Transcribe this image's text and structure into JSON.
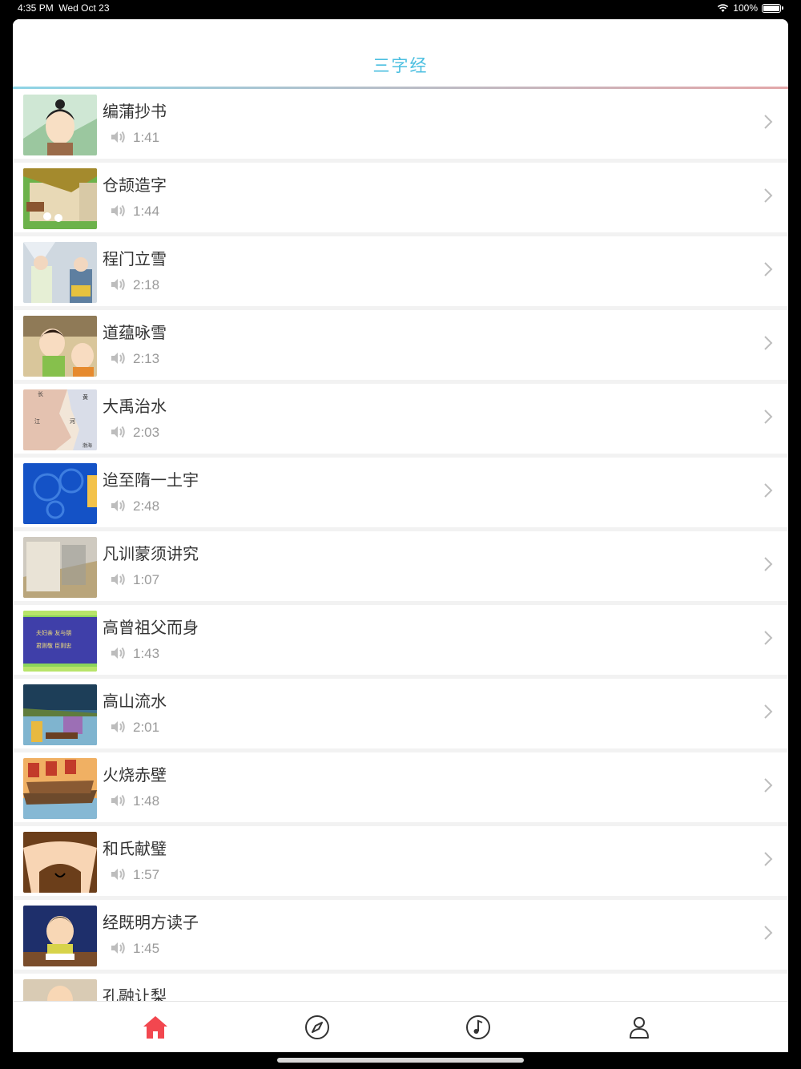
{
  "status": {
    "time": "4:35 PM",
    "date": "Wed Oct 23",
    "battery": "100%"
  },
  "nav": {
    "title": "三字经"
  },
  "items": [
    {
      "title": "编蒲抄书",
      "duration": "1:41",
      "thumb_theme": "girl-portrait"
    },
    {
      "title": "仓颉造字",
      "duration": "1:44",
      "thumb_theme": "house-scene"
    },
    {
      "title": "程门立雪",
      "duration": "2:18",
      "thumb_theme": "snow-scholars"
    },
    {
      "title": "道蕴咏雪",
      "duration": "2:13",
      "thumb_theme": "children"
    },
    {
      "title": "大禹治水",
      "duration": "2:03",
      "thumb_theme": "map"
    },
    {
      "title": "迨至隋一土宇",
      "duration": "2:48",
      "thumb_theme": "blue-rings"
    },
    {
      "title": "凡训蒙须讲究",
      "duration": "1:07",
      "thumb_theme": "scroll"
    },
    {
      "title": "高曾祖父而身",
      "duration": "1:43",
      "thumb_theme": "text-panel"
    },
    {
      "title": "高山流水",
      "duration": "2:01",
      "thumb_theme": "lake"
    },
    {
      "title": "火烧赤壁",
      "duration": "1:48",
      "thumb_theme": "boats"
    },
    {
      "title": "和氏献璧",
      "duration": "1:57",
      "thumb_theme": "face-closeup"
    },
    {
      "title": "经既明方读子",
      "duration": "1:45",
      "thumb_theme": "reading-boy"
    },
    {
      "title": "孔融让梨",
      "duration": "",
      "thumb_theme": "boy-partial"
    }
  ],
  "tabs": [
    {
      "name": "home",
      "icon": "house-icon",
      "active": true
    },
    {
      "name": "discover",
      "icon": "compass-icon",
      "active": false
    },
    {
      "name": "music",
      "icon": "music-note-icon",
      "active": false
    },
    {
      "name": "profile",
      "icon": "user-icon",
      "active": false
    }
  ],
  "colors": {
    "accent": "#4cbfe0",
    "tab_active": "#f2474f",
    "tab_inactive": "#333333"
  }
}
